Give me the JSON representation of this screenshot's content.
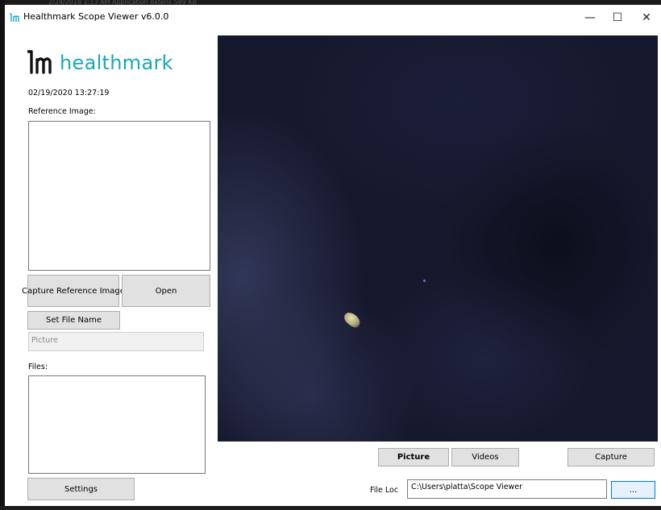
{
  "background": {
    "strip_text": "2/24/2018 1:13 AM    Application extens    589 KB"
  },
  "window": {
    "title": "Healthmark Scope Viewer v6.0.0",
    "controls": {
      "minimize": "—",
      "maximize": "☐",
      "close": "✕"
    }
  },
  "brand": {
    "name": "healthmark",
    "color": "#1aa7b9"
  },
  "left_panel": {
    "datetime": "02/19/2020 13:27:19",
    "reference_label": "Reference Image:",
    "capture_reference_label": "Capture Reference Image",
    "open_label": "Open",
    "set_file_name_label": "Set File Name",
    "file_name_value": "Picture",
    "files_label": "Files:",
    "settings_label": "Settings"
  },
  "bottom_bar": {
    "picture_label": "Picture",
    "videos_label": "Videos",
    "capture_label": "Capture",
    "file_loc_label": "File Loc",
    "file_loc_value": "C:\\Users\\platta\\Scope Viewer",
    "browse_label": "..."
  },
  "icons": [
    "app-logo-icon",
    "healthmark-logo-icon"
  ]
}
